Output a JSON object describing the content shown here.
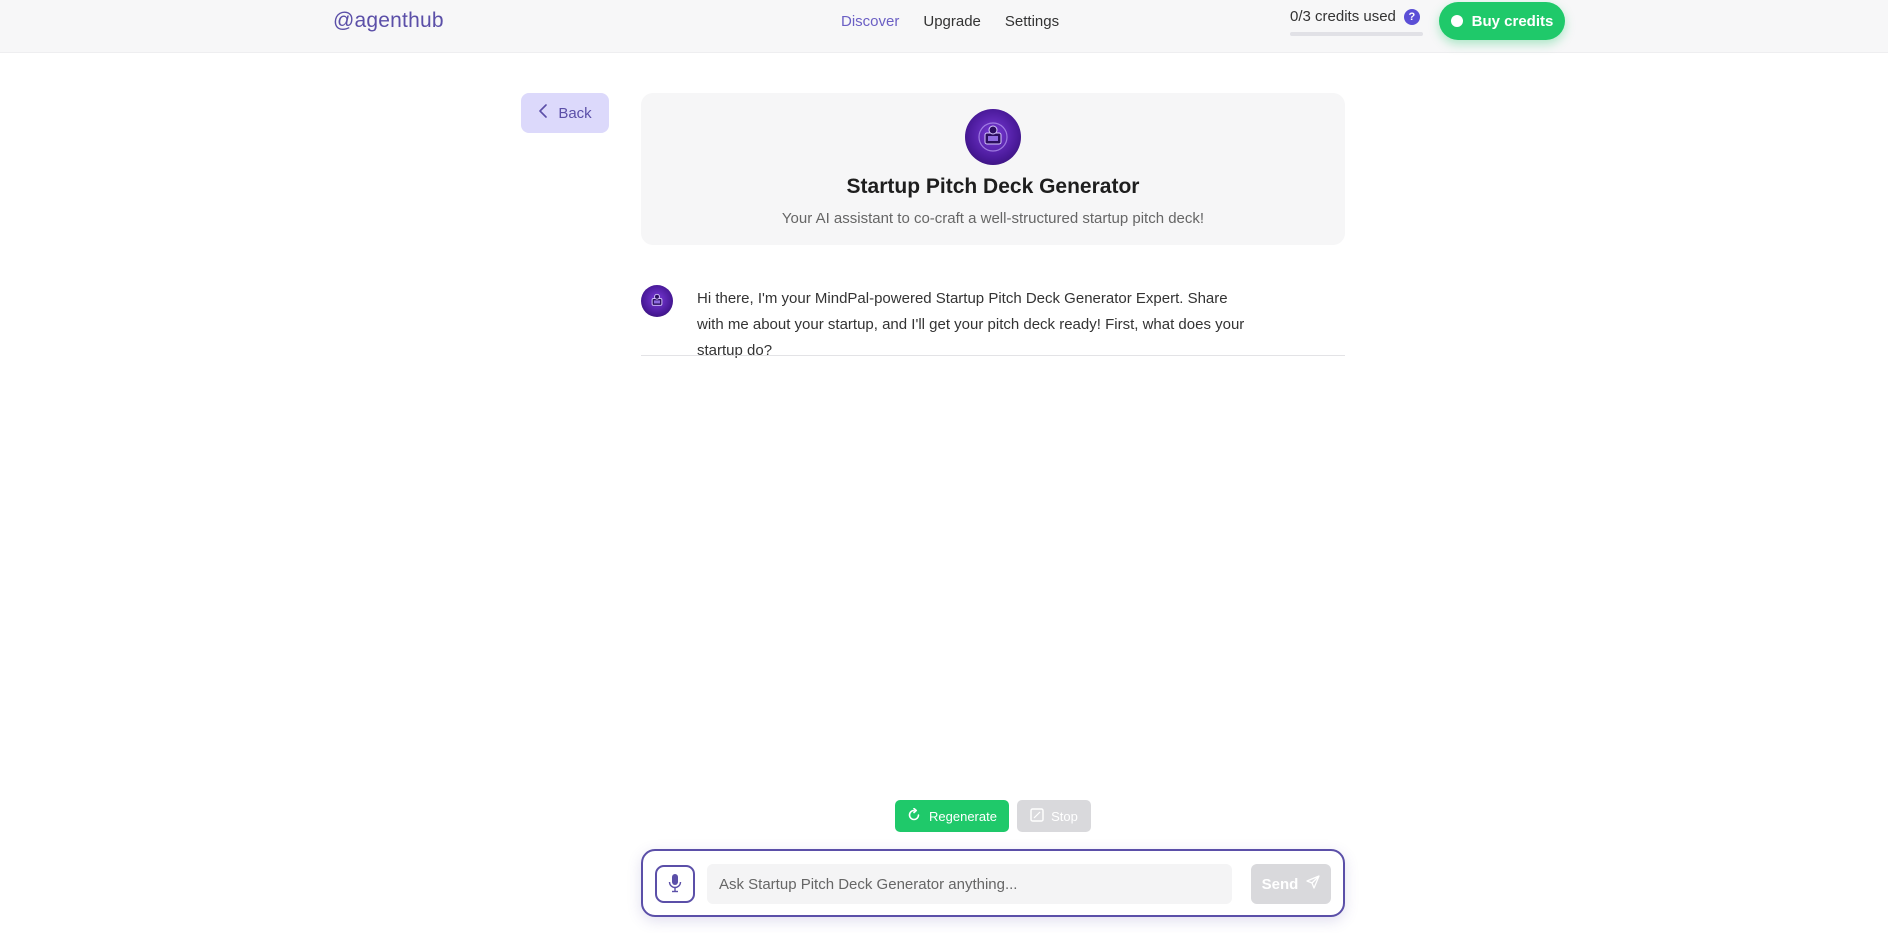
{
  "header": {
    "logo": "@agenthub",
    "nav": [
      {
        "label": "Discover",
        "active": true
      },
      {
        "label": "Upgrade",
        "active": false
      },
      {
        "label": "Settings",
        "active": false
      }
    ],
    "credits_label": "0/3 credits used",
    "credits_help_glyph": "?",
    "credits_used_fraction": 0,
    "buy_credits_label": "Buy credits"
  },
  "back_label": "Back",
  "agent": {
    "title": "Startup Pitch Deck Generator",
    "subtitle": "Your AI assistant to co-craft a well-structured startup pitch deck!",
    "avatar_icon": "agent-avatar-icon"
  },
  "messages": [
    {
      "role": "assistant",
      "text": "Hi there, I'm your MindPal-powered Startup Pitch Deck Generator Expert. Share with me about your startup, and I'll get your pitch deck ready! First, what does your startup do?"
    }
  ],
  "actions": {
    "regenerate_label": "Regenerate",
    "stop_label": "Stop"
  },
  "composer": {
    "placeholder": "Ask Startup Pitch Deck Generator anything...",
    "value": "",
    "send_label": "Send"
  },
  "colors": {
    "accent": "#5b4fa8",
    "brand_green": "#1fc96a",
    "back_bg": "#dcd9fb",
    "disabled": "#d9d9dc"
  }
}
